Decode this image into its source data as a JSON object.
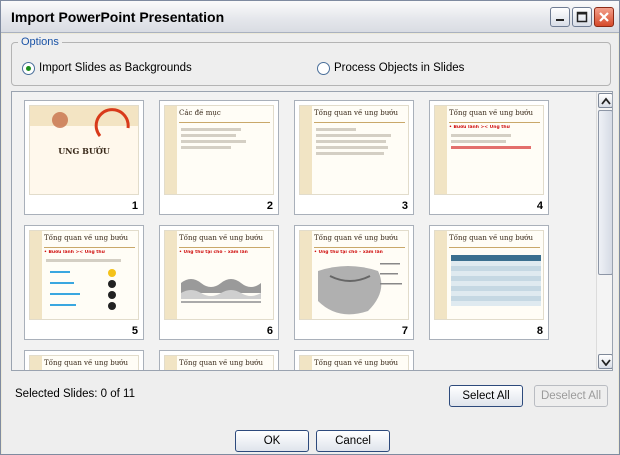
{
  "window": {
    "title": "Import PowerPoint Presentation"
  },
  "options": {
    "legend": "Options",
    "radio_backgrounds": {
      "label": "Import Slides as Backgrounds",
      "selected": true
    },
    "radio_objects": {
      "label": "Process Objects in Slides",
      "selected": false
    }
  },
  "slides": [
    {
      "num": "1",
      "title": "UNG BƯỚU"
    },
    {
      "num": "2",
      "title": "Các đề mục"
    },
    {
      "num": "3",
      "title": "Tổng quan về ung bướu"
    },
    {
      "num": "4",
      "title": "Tổng quan về ung bướu",
      "red": "• Bướu lành >< Ung thư"
    },
    {
      "num": "5",
      "title": "Tổng quan về ung bướu",
      "red": "• Bướu lành >< Ung thư"
    },
    {
      "num": "6",
      "title": "Tổng quan về ung bướu",
      "red": "• Ung thư tại chỗ – xâm lấn"
    },
    {
      "num": "7",
      "title": "Tổng quan về ung bướu",
      "red": "• Ung thư tại chỗ – xâm lấn"
    },
    {
      "num": "8",
      "title": "Tổng quan về ung bướu"
    },
    {
      "num": "",
      "title": "Tổng quan về ung bướu"
    },
    {
      "num": "",
      "title": "Tổng quan về ung bướu"
    },
    {
      "num": "",
      "title": "Tổng quan về ung bướu"
    }
  ],
  "status": {
    "selected_text": "Selected Slides: 0 of 11"
  },
  "buttons": {
    "select_all": "Select All",
    "deselect_all": "Deselect All",
    "ok": "OK",
    "cancel": "Cancel"
  },
  "colors": {
    "accent_legend": "#1a53a6",
    "close_button": "#d64a2a",
    "slide_title_red": "#d01010"
  }
}
